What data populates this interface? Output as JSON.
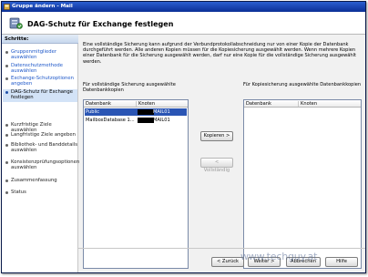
{
  "window": {
    "title": "Gruppe ändern - Mail"
  },
  "header": {
    "title": "DAG-Schutz für Exchange festlegen"
  },
  "steps": {
    "heading": "Schritte:",
    "items": [
      {
        "label": "Gruppenmitglieder auswählen"
      },
      {
        "label": "Datenschutzmethode auswählen"
      },
      {
        "label": "Exchange-Schutzoptionen angeben"
      },
      {
        "label": "DAG-Schutz für Exchange festlegen"
      },
      {
        "label": "Kurzfristige Ziele auswählen"
      },
      {
        "label": "Langfristige Ziele angeben"
      },
      {
        "label": "Bibliothek- und Banddetails auswählen"
      },
      {
        "label": "Konsistenzprüfungsoptionen auswählen"
      },
      {
        "label": "Zusammenfassung"
      },
      {
        "label": "Status"
      }
    ]
  },
  "main": {
    "description": "Eine vollständige Sicherung kann aufgrund der Verbundprotokollabschneidung nur von einer Kopie der Datenbank durchgeführt werden. Alle anderen Kopien müssen für die Kopiesicherung ausgewählt werden. Wenn mehrere Kopien einer Datenbank für die Sicherung ausgewählt werden, darf nur eine Kopie für die vollständige Sicherung ausgewählt werden.",
    "left_label": "Für vollständige Sicherung ausgewählte Datenbankkopien",
    "right_label": "Für Kopiesicherung ausgewählte Datenbankkopien",
    "columns": {
      "database": "Datenbank",
      "node": "Knoten"
    },
    "left_rows": [
      {
        "database": "Public",
        "node": "MAIL01"
      },
      {
        "database": "MailboxDatabase 1...",
        "node": "MAIL01"
      }
    ],
    "copy_button": "Kopieren >",
    "full_button": "< Vollständig"
  },
  "footer": {
    "back_button": "< Zurück",
    "next_button": "Weiter >",
    "cancel_button": "Abbrechen",
    "help_button": "Hilfe"
  },
  "watermark": "www.techguy.at"
}
